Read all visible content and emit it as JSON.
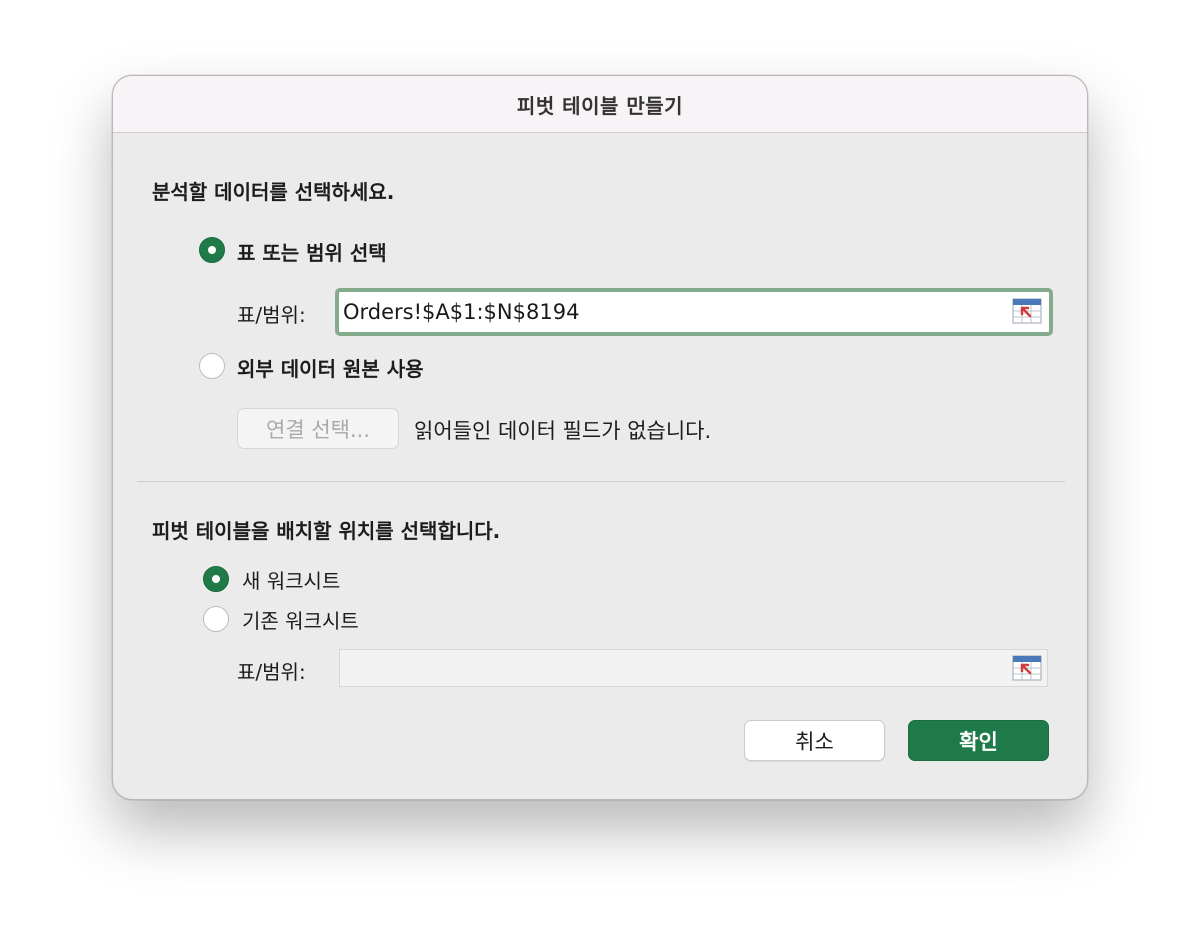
{
  "dialog": {
    "title": "피벗 테이블 만들기"
  },
  "data_source": {
    "heading": "분석할 데이터를 선택하세요.",
    "option_table_label": "표 또는 범위 선택",
    "option_table_selected": true,
    "table_range_label": "표/범위:",
    "table_range_value": "Orders!$A$1:$N$8194",
    "option_external_label": "외부 데이터 원본 사용",
    "option_external_selected": false,
    "choose_connection_label": "연결 선택...",
    "no_fields_text": "읽어들인 데이터 필드가 없습니다."
  },
  "placement": {
    "heading": "피벗 테이블을 배치할 위치를 선택합니다.",
    "option_new_label": "새 워크시트",
    "option_new_selected": true,
    "option_existing_label": "기존 워크시트",
    "option_existing_selected": false,
    "location_label": "표/범위:",
    "location_value": ""
  },
  "buttons": {
    "cancel_label": "취소",
    "ok_label": "확인"
  },
  "icons": {
    "range_picker": "range-select-icon"
  },
  "colors": {
    "accent": "#1e7b49",
    "focus_ring": "#85ab8d"
  }
}
